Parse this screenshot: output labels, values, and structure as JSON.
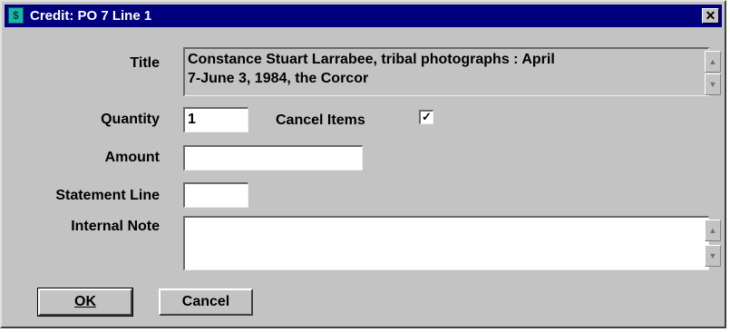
{
  "window": {
    "title": "Credit: PO 7 Line 1",
    "icon_glyph": "$",
    "close_glyph": "✕"
  },
  "form": {
    "title_label": "Title",
    "title_line1": "Constance Stuart Larrabee, tribal photographs : April",
    "title_line2": "7-June 3, 1984, the Corcor",
    "quantity_label": "Quantity",
    "quantity_value": "1",
    "cancel_items_label": "Cancel Items",
    "cancel_items_checked": true,
    "cancel_items_mark": "✓",
    "amount_label": "Amount",
    "amount_value": "",
    "statement_line_label": "Statement Line",
    "statement_line_value": "",
    "internal_note_label": "Internal Note",
    "internal_note_value": ""
  },
  "buttons": {
    "ok_label": "OK",
    "cancel_label": "Cancel"
  },
  "scroll": {
    "up_glyph": "▲",
    "down_glyph": "▼"
  },
  "colors": {
    "titlebar": "#00007f",
    "dialog_bg": "#c3c3c3",
    "icon": "#18b8a8"
  }
}
